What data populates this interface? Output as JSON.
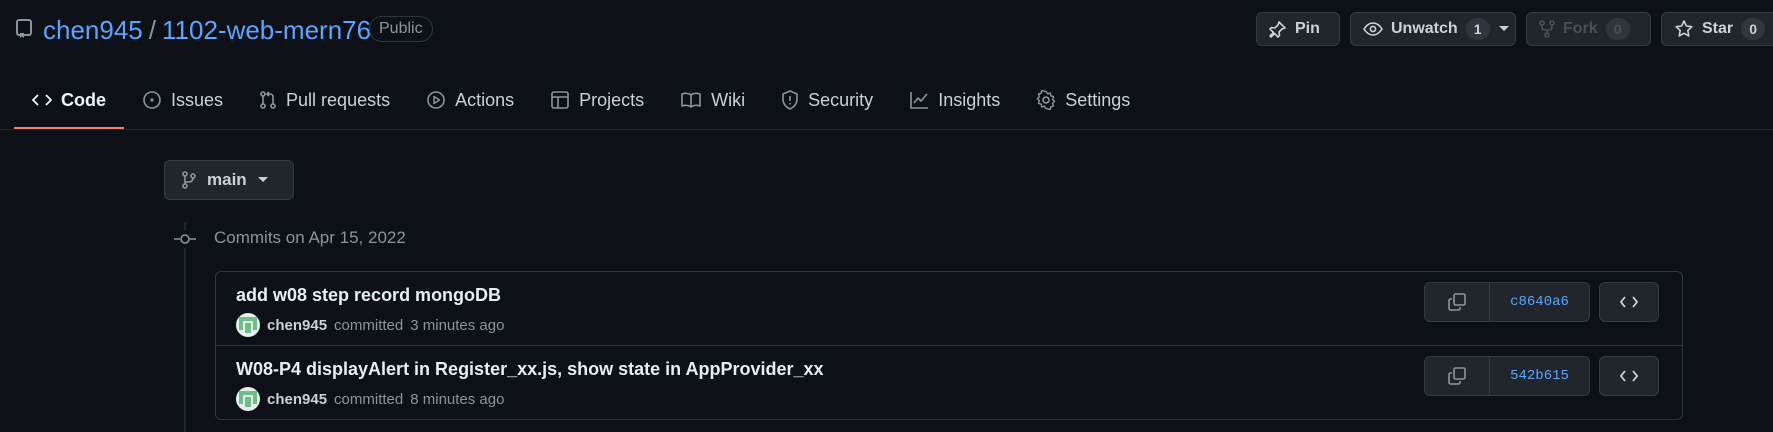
{
  "repo": {
    "owner": "chen945",
    "separator": "/",
    "name": "1102-web-mern76",
    "visibility": "Public"
  },
  "actions": {
    "pin": "Pin",
    "unwatch": "Unwatch",
    "watch_count": "1",
    "fork": "Fork",
    "fork_count": "0",
    "star": "Star",
    "star_count": "0"
  },
  "tabs": [
    {
      "label": "Code",
      "icon": "code-icon",
      "active": true
    },
    {
      "label": "Issues",
      "icon": "issue-icon"
    },
    {
      "label": "Pull requests",
      "icon": "pull-request-icon"
    },
    {
      "label": "Actions",
      "icon": "play-icon"
    },
    {
      "label": "Projects",
      "icon": "table-icon"
    },
    {
      "label": "Wiki",
      "icon": "book-icon"
    },
    {
      "label": "Security",
      "icon": "shield-icon"
    },
    {
      "label": "Insights",
      "icon": "graph-icon"
    },
    {
      "label": "Settings",
      "icon": "gear-icon"
    }
  ],
  "branch": {
    "name": "main"
  },
  "commits_header": "Commits on Apr 15, 2022",
  "commits": [
    {
      "message": "add w08 step record mongoDB",
      "author": "chen945",
      "action": "committed",
      "time": "3 minutes ago",
      "sha": "c8640a6"
    },
    {
      "message": "W08-P4 displayAlert in Register_xx.js, show state in AppProvider_xx",
      "author": "chen945",
      "action": "committed",
      "time": "8 minutes ago",
      "sha": "542b615"
    }
  ],
  "colors": {
    "accent": "#58a6ff",
    "active_tab_underline": "#f78166",
    "background": "#0d1117"
  }
}
